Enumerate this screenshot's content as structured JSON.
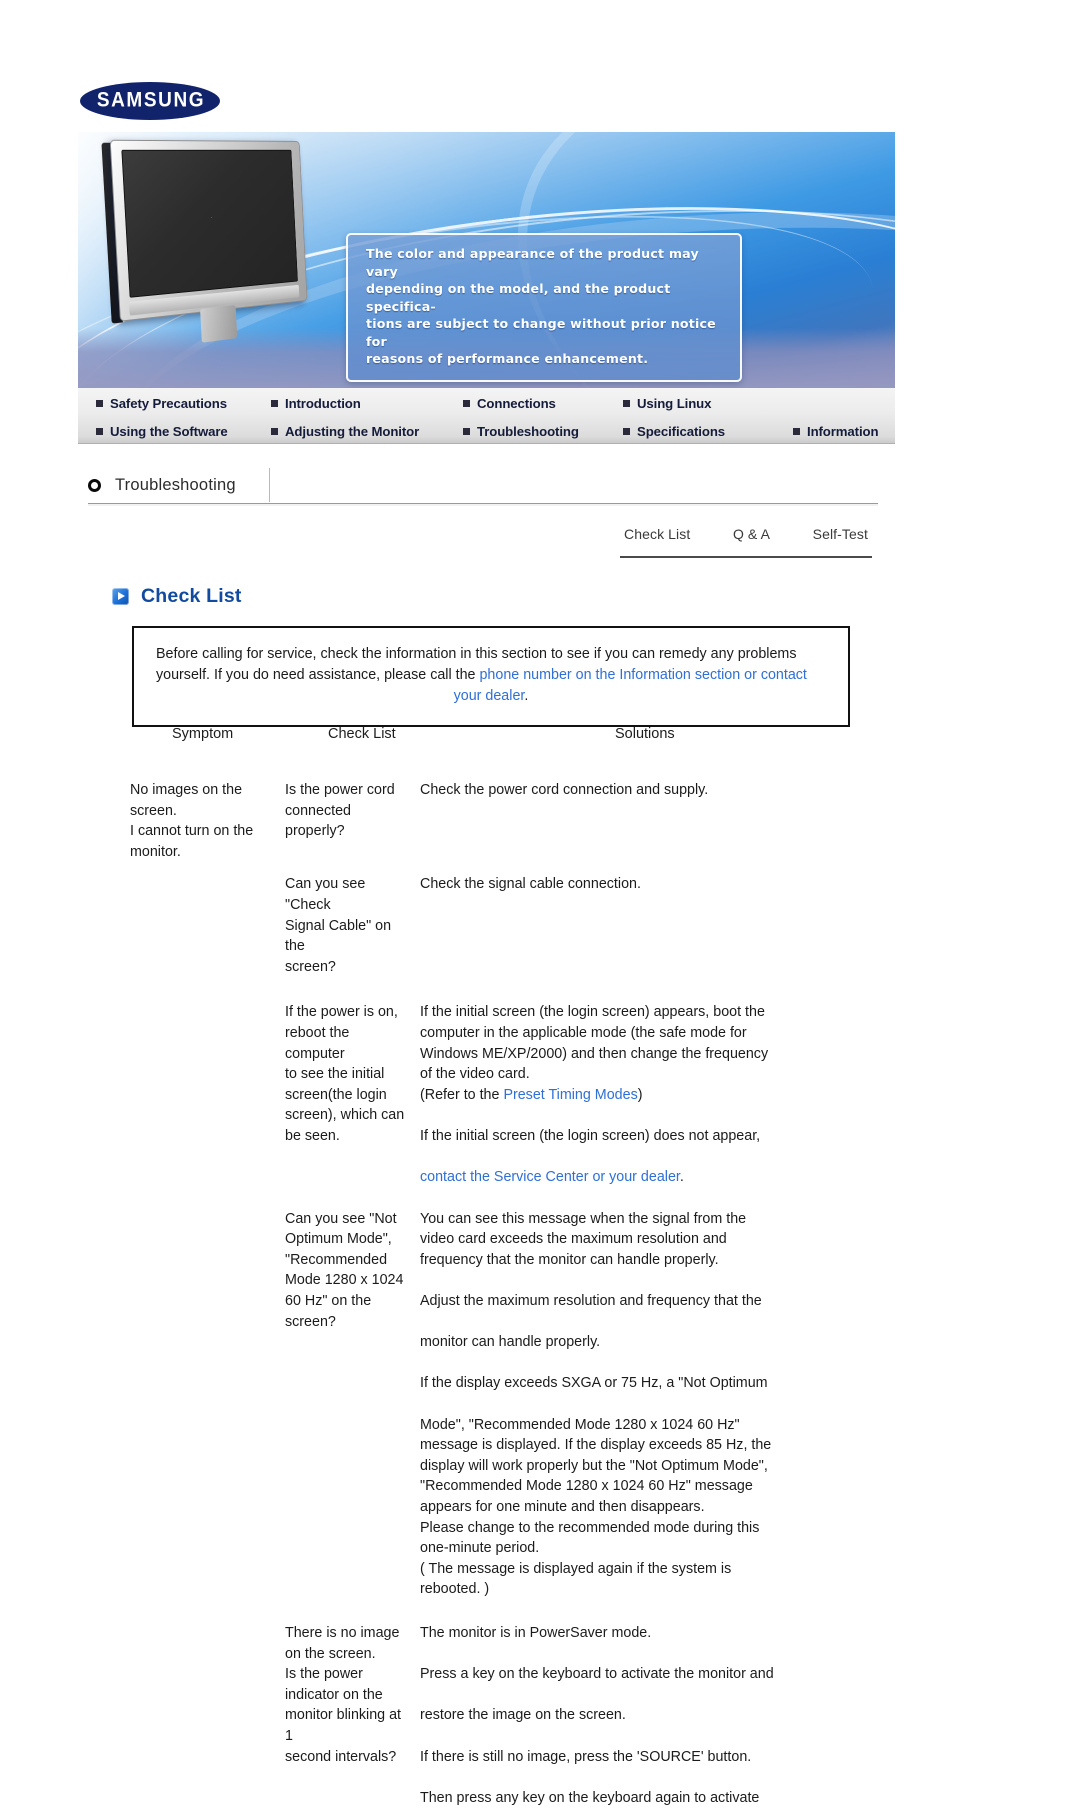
{
  "brand": {
    "logo_text": "SAMSUNG"
  },
  "banner": {
    "notice": "The color and appearance of the product may vary depending on the model, and the product specifica-tions are subject to change without prior notice for reasons of performance enhancement.",
    "notice_lines": [
      "The color and appearance of the product may vary",
      "depending on the model, and the product specifica-",
      "tions are subject to change without prior notice for",
      "reasons of performance enhancement."
    ]
  },
  "nav": {
    "row1": [
      {
        "label": "Safety Precautions"
      },
      {
        "label": "Introduction"
      },
      {
        "label": "Connections"
      },
      {
        "label": "Using Linux"
      }
    ],
    "row2": [
      {
        "label": "Using the Software"
      },
      {
        "label": "Adjusting the Monitor"
      },
      {
        "label": "Troubleshooting"
      },
      {
        "label": "Specifications"
      },
      {
        "label": "Information"
      }
    ]
  },
  "page": {
    "title": "Troubleshooting",
    "tabs": [
      {
        "label": "Check List"
      },
      {
        "label": "Q & A"
      },
      {
        "label": "Self-Test"
      }
    ],
    "section_heading": "Check List"
  },
  "info_box": {
    "line1": "Before calling for service, check the information in this section to see if you can remedy any problems",
    "line2_pre": "yourself. If you do need assistance, please call the ",
    "line2_link": "phone number on the Information section or contact",
    "line3_link": "your dealer",
    "line3_suffix": "."
  },
  "table": {
    "headers": {
      "symptom": "Symptom",
      "check_list": "Check List",
      "solutions": "Solutions"
    },
    "rows": [
      {
        "symptom": "No images on the screen.\nI cannot turn on the monitor.",
        "check": "Is the power cord connected properly?",
        "solutions": [
          "Check the power cord connection and supply."
        ]
      },
      {
        "symptom": "",
        "check": "Can you see \"Check Signal Cable\" on the screen?",
        "solutions": [
          "Check the signal cable connection."
        ]
      },
      {
        "symptom": "",
        "check": "If the power is on, reboot the computer to see the initial screen(the login screen), which can be seen.",
        "solutions": [
          "If the initial screen (the login screen) appears, boot the computer in the applicable mode (the safe mode for Windows ME/XP/2000) and then change the frequency of the video card.",
          "(Refer to the Preset Timing Modes)",
          "If the initial screen (the login screen) does not appear, contact the Service Center or your dealer."
        ],
        "links": [
          "Preset Timing Modes",
          "contact the Service Center or your dealer"
        ]
      },
      {
        "symptom": "",
        "check": "Can you see \"Not Optimum Mode\", \"Recommended Mode 1280 x 1024 60 Hz\" on the screen?",
        "solutions": [
          "You can see this message when the signal from the video card exceeds the maximum resolution and frequency that the monitor can handle properly.",
          "Adjust the maximum resolution and frequency that the monitor can handle properly.",
          "If the display exceeds SXGA or 75 Hz, a \"Not Optimum Mode\", \"Recommended Mode 1280 x 1024 60 Hz\" message is displayed. If the display exceeds 85 Hz, the display will work properly but the \"Not Optimum Mode\", \"Recommended Mode 1280 x 1024 60 Hz\" message appears for one minute and then disappears.",
          "Please change to the recommended mode during this one-minute period.",
          "( The message is displayed again if the system is rebooted. )"
        ]
      },
      {
        "symptom": "",
        "check": "There is no image on the screen. Is the power indicator on the monitor blinking at 1 second intervals?",
        "solutions": [
          "The monitor is in PowerSaver mode.",
          "Press a key on the keyboard to activate the monitor and restore the image on the screen.",
          "If there is still no image, press the 'SOURCE' button. Then press any key on the keyboard again to activate"
        ]
      }
    ],
    "cells": {
      "r1_symptom_l1": "No images on the",
      "r1_symptom_l2": "screen.",
      "r1_symptom_l3": "I cannot turn on the",
      "r1_symptom_l4": "monitor.",
      "r1_check_l1": "Is the power cord",
      "r1_check_l2": "connected properly?",
      "r1_sol_l1": "Check the power cord connection and supply.",
      "r2_check_l1": "Can you see \"Check",
      "r2_check_l2": "Signal Cable\" on the",
      "r2_check_l3": "screen?",
      "r2_sol_l1": "Check the signal cable connection.",
      "r3_check_l1": "If the power is on,",
      "r3_check_l2": "reboot the computer",
      "r3_check_l3": "to see the initial",
      "r3_check_l4": "screen(the login",
      "r3_check_l5": "screen), which can",
      "r3_check_l6": "be seen.",
      "r3_sol_p1_l1": "If the initial screen (the login screen) appears, boot the",
      "r3_sol_p1_l2": "computer in the applicable mode (the safe mode for",
      "r3_sol_p1_l3": "Windows ME/XP/2000) and then change the frequency",
      "r3_sol_p1_l4": "of the video card.",
      "r3_sol_p2_pre": "(Refer to the ",
      "r3_sol_p2_link": "Preset Timing Modes",
      "r3_sol_p2_post": ")",
      "r3_sol_p3_l1": "If the initial screen (the login screen) does not appear,",
      "r3_sol_p3_link": "contact the Service Center or your dealer",
      "r3_sol_p3_post": ".",
      "r4_check_l1": "Can you see \"Not",
      "r4_check_l2": "Optimum Mode\",",
      "r4_check_l3": "\"Recommended",
      "r4_check_l4": "Mode 1280 x 1024",
      "r4_check_l5": "60 Hz\" on the",
      "r4_check_l6": "screen?",
      "r4_sol_p1_l1": "You can see this message when the signal from the",
      "r4_sol_p1_l2": "video card exceeds the maximum resolution and",
      "r4_sol_p1_l3": "frequency that the monitor can handle properly.",
      "r4_sol_p2_l1": "Adjust the maximum resolution and frequency that the",
      "r4_sol_p2_l2": "monitor can handle properly.",
      "r4_sol_p3_l1": "If the display exceeds SXGA or 75 Hz, a \"Not Optimum",
      "r4_sol_p3_l2": "Mode\", \"Recommended Mode 1280 x 1024 60 Hz\"",
      "r4_sol_p3_l3": "message is displayed. If the display exceeds 85 Hz, the",
      "r4_sol_p3_l4": "display will work properly but the \"Not Optimum Mode\",",
      "r4_sol_p3_l5": "\"Recommended Mode 1280 x 1024 60 Hz\" message",
      "r4_sol_p3_l6": "appears for one minute and then disappears.",
      "r4_sol_p3_l7": "Please change to the recommended mode during this",
      "r4_sol_p3_l8": "one-minute period.",
      "r4_sol_p3_l9": "( The message is displayed again if the system is",
      "r4_sol_p3_l10": "rebooted. )",
      "r5_check_l1": "There is no image",
      "r5_check_l2": "on the screen.",
      "r5_check_l3": "Is the power",
      "r5_check_l4": "indicator on the",
      "r5_check_l5": "monitor blinking at 1",
      "r5_check_l6": "second intervals?",
      "r5_sol_p1_l1": "The monitor is in PowerSaver mode.",
      "r5_sol_p2_l1": "Press a key on the keyboard to activate the monitor and",
      "r5_sol_p2_l2": "restore the image on the screen.",
      "r5_sol_p3_l1": "If there is still no image, press the 'SOURCE' button.",
      "r5_sol_p3_l2": "Then press any key on the keyboard again to activate"
    }
  },
  "colors": {
    "brand_blue": "#11236b",
    "heading_blue": "#114a9e",
    "link_blue": "#2f6fd6",
    "nav_text": "#151b3a"
  }
}
